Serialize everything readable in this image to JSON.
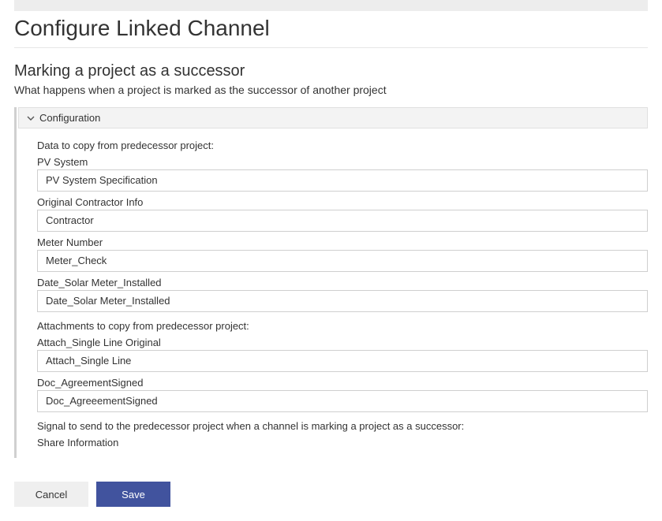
{
  "page": {
    "title": "Configure Linked Channel",
    "subheading": "Marking a project as a successor",
    "subdesc": "What happens when a project is marked as the successor of another project"
  },
  "section": {
    "title": "Configuration",
    "data_to_copy_label": "Data to copy from predecessor project:",
    "attachments_to_copy_label": "Attachments to copy from predecessor project:",
    "signal_label": "Signal to send to the predecessor project when a channel is marking a project as a successor:",
    "fields_data": [
      {
        "label": "PV System",
        "value": "PV System Specification"
      },
      {
        "label": "Original Contractor Info",
        "value": "Contractor"
      },
      {
        "label": "Meter Number",
        "value": "Meter_Check"
      },
      {
        "label": "Date_Solar Meter_Installed",
        "value": "Date_Solar Meter_Installed"
      }
    ],
    "fields_attach": [
      {
        "label": "Attach_Single Line Original",
        "value": "Attach_Single Line"
      },
      {
        "label": "Doc_AgreementSigned",
        "value": "Doc_AgreeementSigned"
      }
    ],
    "signal_value": "Share Information"
  },
  "buttons": {
    "cancel": "Cancel",
    "save": "Save"
  }
}
